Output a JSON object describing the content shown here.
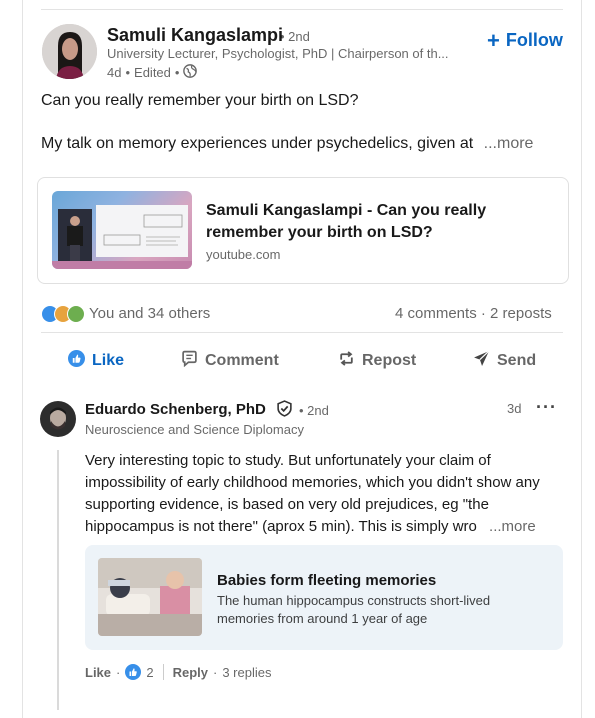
{
  "post": {
    "author": {
      "name": "Samuli Kangaslampi",
      "degree": "2nd",
      "headline": "University Lecturer, Psychologist, PhD | Chairperson of th...",
      "time": "4d",
      "edited": "Edited"
    },
    "follow_label": "Follow",
    "text_line1": "Can you really remember your birth on LSD?",
    "text_line2": "My talk on memory experiences under psychedelics, given at",
    "more_label": "...more",
    "link_card": {
      "title": "Samuli Kangaslampi - Can you really remember your birth on LSD?",
      "source": "youtube.com"
    },
    "reactions_text": "You and 34 others",
    "comments_count": "4 comments",
    "reposts_count": "2 reposts",
    "actions": {
      "like": "Like",
      "comment": "Comment",
      "repost": "Repost",
      "send": "Send"
    }
  },
  "comment": {
    "author": {
      "name": "Eduardo Schenberg, PhD",
      "degree": "2nd",
      "headline": "Neuroscience and Science Diplomacy",
      "time": "3d"
    },
    "text": "Very interesting topic to study. But unfortunately your claim of impossibility of early childhood memories, which you didn't show any supporting evidence, is based on very old prejudices, eg \"the hippocampus is not there\" (aprox 5 min). This is simply wro",
    "more_label": "...more",
    "article": {
      "title": "Babies form fleeting memories",
      "description": "The human hippocampus constructs short-lived memories from around 1 year of age"
    },
    "like_label": "Like",
    "like_count": "2",
    "reply_label": "Reply",
    "replies": "3 replies"
  },
  "colors": {
    "accent": "#0a66c2",
    "article_bg": "#edf3f8"
  }
}
